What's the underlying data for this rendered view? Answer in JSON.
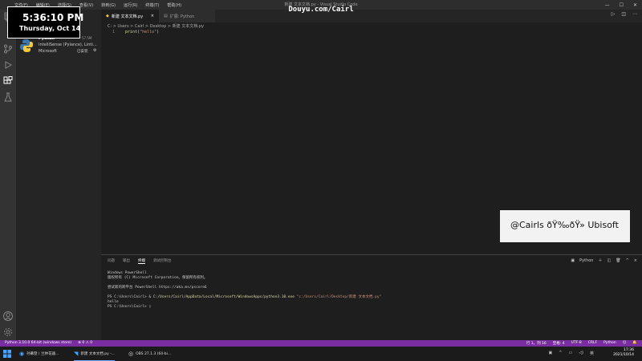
{
  "titlebar": {
    "menus": [
      "文件(F)",
      "编辑(E)",
      "选择(S)",
      "查看(V)",
      "转到(G)",
      "运行(R)",
      "终端(T)",
      "帮助(H)"
    ],
    "window_title": "新建 文本文档.py - Visual Studio Code"
  },
  "sidebar": {
    "extension": {
      "name": "Python",
      "description": "IntelliSense (Pylance), Linting...",
      "publisher": "Microsoft",
      "downloads": "57.5M",
      "status": "已安装"
    }
  },
  "tabs": [
    {
      "label": "新建 文本文档.py",
      "active": true
    },
    {
      "label": "扩展: Python",
      "active": false
    }
  ],
  "breadcrumb": "C: > Users > Cairl > Desktop > 新建 文本文档.py",
  "editor": {
    "line_number": "1",
    "code_keyword": "print",
    "code_open": "(",
    "code_string": "\"hello\"",
    "code_close": ")"
  },
  "panel": {
    "tabs": [
      "问题",
      "输出",
      "终端",
      "调试控制台"
    ],
    "active_tab": "终端",
    "shell_label": "Python",
    "terminal": {
      "line1": "Windows PowerShell",
      "line2": "版权所有 (C) Microsoft Corporation。保留所有权利。",
      "line3": "尝试新的跨平台 PowerShell https://aka.ms/pscore6",
      "cmd_prompt": "PS C:\\Users\\Cairl> & ",
      "cmd_exe": "C:/Users/Cairl/AppData/Local/Microsoft/WindowsApps/python3.10.exe",
      "cmd_arg": " \"c:/Users/Cairl/Desktop/新建 文本文档.py\"",
      "output": "hello",
      "prompt2": "PS C:\\Users\\Cairl> "
    }
  },
  "statusbar": {
    "interpreter": "Python 3.10.0 64-bit (windows store)",
    "errors": "0",
    "warnings": "0",
    "position": "行 1，列 16",
    "spaces": "空格: 4",
    "encoding": "UTF-8",
    "eol": "CRLF",
    "language": "Python"
  },
  "taskbar": {
    "items": [
      "孙幕登丨兰林花器...",
      "新建 文本文档.py -...",
      "OBS 27.1.3 (64-bi..."
    ],
    "tray_lang": "英",
    "time": "17:36",
    "date": "2021/10/14"
  },
  "overlay": {
    "clock_time": "5:36:10 PM",
    "clock_date": "Thursday, Oct 14",
    "watermark": "Douyu.com/Cairl",
    "social": "@Cairls ðŸ‰ðŸ» Ubisoft"
  },
  "colors": {
    "statusbar": "#7a2da0",
    "editor_bg": "#1e1e1e",
    "sidebar_bg": "#252526",
    "activitybar_bg": "#333333"
  }
}
